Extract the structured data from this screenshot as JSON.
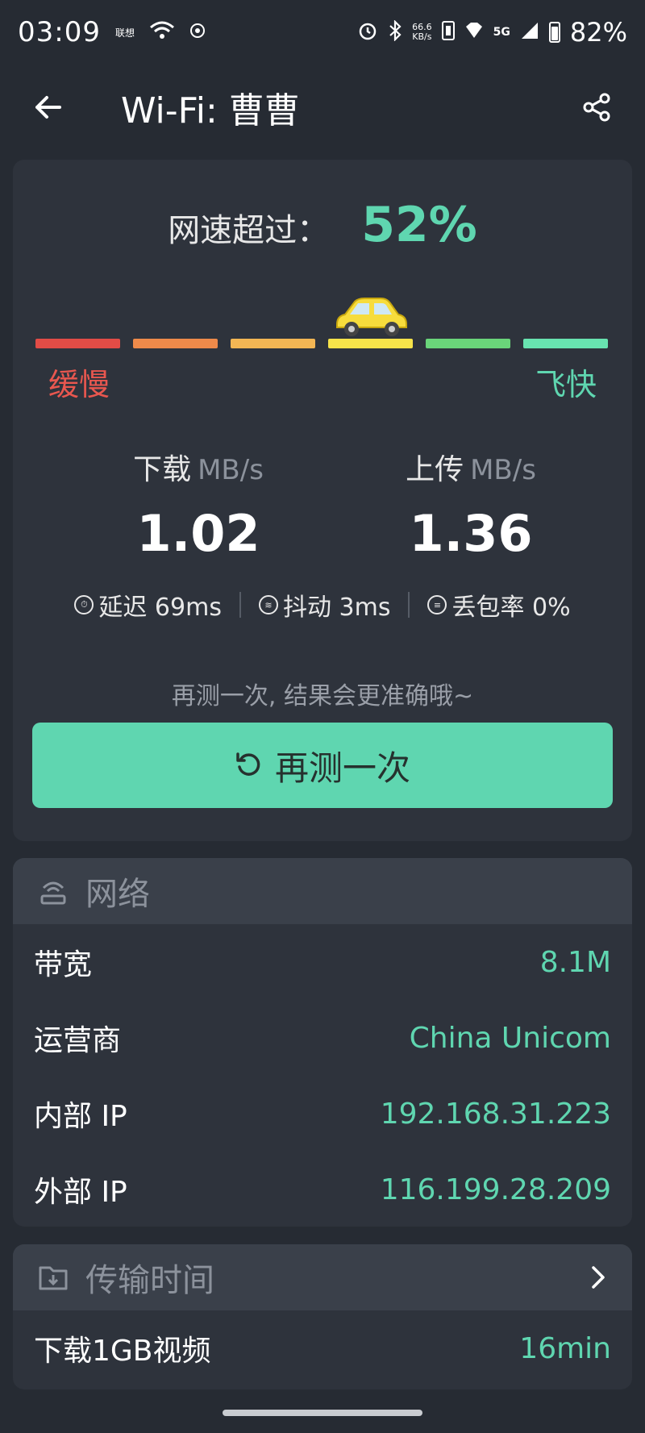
{
  "status_bar": {
    "time": "03:09",
    "carrier_badge": "联想",
    "net_speed_value": "66.6",
    "net_speed_unit": "KB/s",
    "network_type": "5G",
    "battery": "82%"
  },
  "app_bar": {
    "title": "Wi-Fi: 曹曹"
  },
  "speed_card": {
    "exceed_label": "网速超过：",
    "exceed_value": "52%",
    "slow_label": "缓慢",
    "fast_label": "飞快",
    "gauge_segment_colors": [
      "#e24c46",
      "#ee8a4a",
      "#f3b654",
      "#f6e34a",
      "#6ad57a",
      "#68e3b0"
    ],
    "gauge_level_segment": 4,
    "download_label": "下载",
    "download_unit": "MB/s",
    "download_value": "1.02",
    "upload_label": "上传",
    "upload_unit": "MB/s",
    "upload_value": "1.36",
    "latency": "延迟 69ms",
    "jitter": "抖动 3ms",
    "packet_loss": "丢包率 0%",
    "hint": "再测一次, 结果会更准确哦~",
    "retest_label": "再测一次"
  },
  "network_section": {
    "title": "网络",
    "rows": [
      {
        "key": "带宽",
        "value": "8.1M"
      },
      {
        "key": "运营商",
        "value": "China Unicom"
      },
      {
        "key": "内部 IP",
        "value": "192.168.31.223"
      },
      {
        "key": "外部 IP",
        "value": "116.199.28.209"
      }
    ]
  },
  "transfer_section": {
    "title": "传输时间",
    "rows": [
      {
        "key": "下载1GB视频",
        "value": "16min"
      }
    ]
  },
  "colors": {
    "accent": "#5fd6b0",
    "background": "#262b33",
    "card": "#2e333c",
    "slow": "#e9574f"
  },
  "icons": {
    "back": "arrow-left-icon",
    "share": "share-icon",
    "car": "car-icon",
    "retest": "refresh-icon",
    "network": "router-icon",
    "transfer": "folder-download-icon",
    "more": "chevron-right-icon"
  }
}
